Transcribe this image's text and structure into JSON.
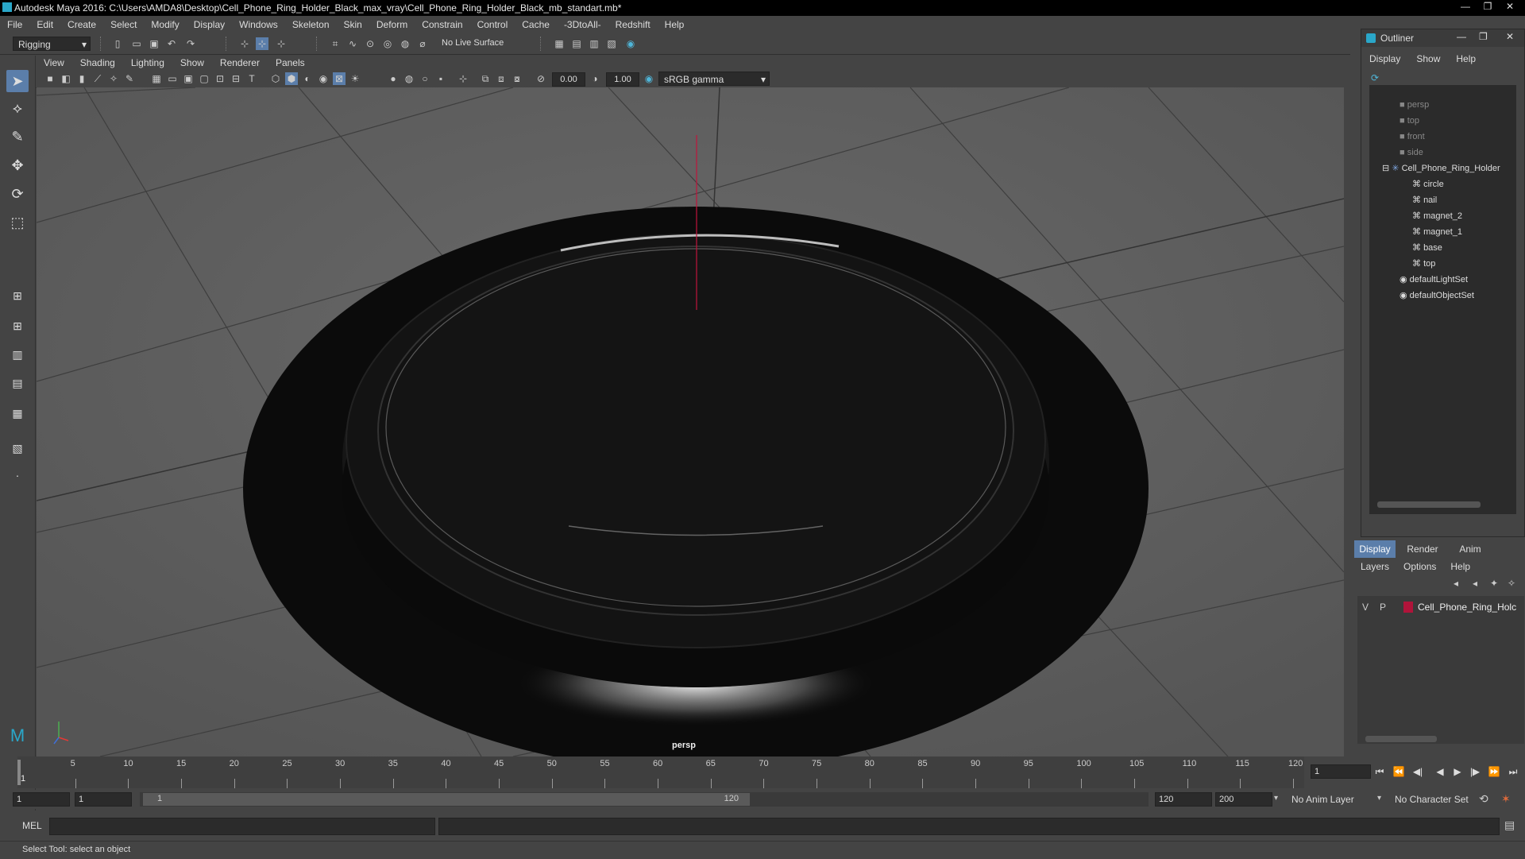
{
  "window": {
    "title": "Autodesk Maya 2016: C:\\Users\\AMDA8\\Desktop\\Cell_Phone_Ring_Holder_Black_max_vray\\Cell_Phone_Ring_Holder_Black_mb_standart.mb*",
    "min": "—",
    "max": "❐",
    "close": "✕"
  },
  "menubar": [
    "File",
    "Edit",
    "Create",
    "Select",
    "Modify",
    "Display",
    "Windows",
    "Skeleton",
    "Skin",
    "Deform",
    "Constrain",
    "Control",
    "Cache",
    "-3DtoAll-",
    "Redshift",
    "Help"
  ],
  "shelf": {
    "mode": "Rigging",
    "live_surface": "No Live Surface"
  },
  "panel": {
    "menu": [
      "View",
      "Shading",
      "Lighting",
      "Show",
      "Renderer",
      "Panels"
    ],
    "exposure": "0.00",
    "gamma": "1.00",
    "colorspace": "sRGB gamma",
    "camera_label": "persp"
  },
  "outliner": {
    "title": "Outliner",
    "menu": [
      "Display",
      "Show",
      "Help"
    ],
    "items": [
      {
        "label": "persp",
        "depth": 0,
        "dim": true,
        "icon": "camera-icon"
      },
      {
        "label": "top",
        "depth": 0,
        "dim": true,
        "icon": "camera-icon"
      },
      {
        "label": "front",
        "depth": 0,
        "dim": true,
        "icon": "camera-icon"
      },
      {
        "label": "side",
        "depth": 0,
        "dim": true,
        "icon": "camera-icon"
      },
      {
        "label": "Cell_Phone_Ring_Holder",
        "depth": 0,
        "dim": false,
        "icon": "group-icon"
      },
      {
        "label": "circle",
        "depth": 1,
        "dim": false,
        "icon": "mesh-icon"
      },
      {
        "label": "nail",
        "depth": 1,
        "dim": false,
        "icon": "mesh-icon"
      },
      {
        "label": "magnet_2",
        "depth": 1,
        "dim": false,
        "icon": "mesh-icon"
      },
      {
        "label": "magnet_1",
        "depth": 1,
        "dim": false,
        "icon": "mesh-icon"
      },
      {
        "label": "base",
        "depth": 1,
        "dim": false,
        "icon": "mesh-icon"
      },
      {
        "label": "top",
        "depth": 1,
        "dim": false,
        "icon": "mesh-icon"
      },
      {
        "label": "defaultLightSet",
        "depth": 0,
        "dim": false,
        "icon": "set-icon"
      },
      {
        "label": "defaultObjectSet",
        "depth": 0,
        "dim": false,
        "icon": "set-icon"
      }
    ]
  },
  "layers": {
    "tabs": [
      "Display",
      "Render",
      "Anim"
    ],
    "menu": [
      "Layers",
      "Options",
      "Help"
    ],
    "row": {
      "v": "V",
      "p": "P",
      "name": "Cell_Phone_Ring_Holc",
      "color": "#b0143a"
    }
  },
  "timeline": {
    "ticks": [
      "5",
      "10",
      "15",
      "20",
      "25",
      "30",
      "35",
      "40",
      "45",
      "50",
      "55",
      "60",
      "65",
      "70",
      "75",
      "80",
      "85",
      "90",
      "95",
      "100",
      "105",
      "110",
      "115",
      "120"
    ],
    "start_marker": "1",
    "current_frame": "1"
  },
  "range": {
    "start": "1",
    "playback_start": "1",
    "slider_start": "1",
    "slider_end": "120",
    "playback_end": "120",
    "end": "200",
    "anim_layer": "No Anim Layer",
    "char_set": "No Character Set"
  },
  "cmd": {
    "label": "MEL"
  },
  "help": {
    "text": "Select Tool: select an object"
  }
}
